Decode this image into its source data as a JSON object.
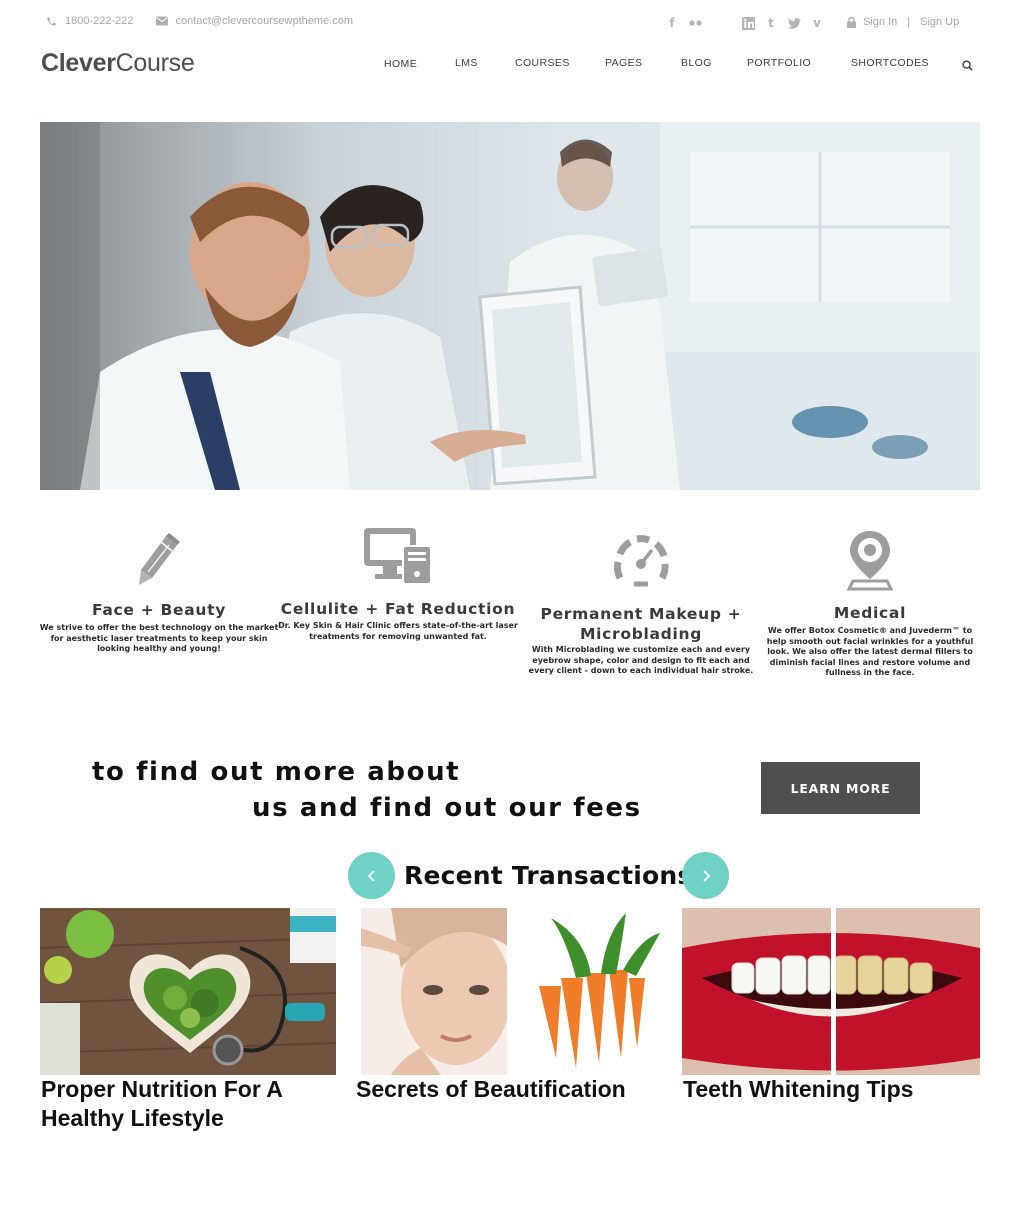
{
  "topbar": {
    "phone": "1800-222-222",
    "email": "contact@clevercoursewptheme.com",
    "sign_in": "Sign In",
    "separator": "|",
    "sign_up": "Sign Up",
    "social_icons": [
      "facebook-icon",
      "flickr-icon",
      "linkedin-icon",
      "tumblr-icon",
      "twitter-icon",
      "vimeo-icon"
    ]
  },
  "logo": {
    "bold": "Clever",
    "light": "Course"
  },
  "nav": {
    "items": [
      "HOME",
      "LMS",
      "COURSES",
      "PAGES",
      "BLOG",
      "PORTFOLIO",
      "SHORTCODES"
    ],
    "search_icon": "search-icon"
  },
  "features": [
    {
      "icon": "pencil-icon",
      "title": "Face + Beauty",
      "text": "We strive to offer the best technology on the market for aesthetic laser treatments to keep your skin looking healthy and young!"
    },
    {
      "icon": "computer-icon",
      "title": "Cellulite + Fat Reduction",
      "text": "Dr. Key Skin & Hair Clinic offers state-of-the-art laser treatments for removing unwanted fat."
    },
    {
      "icon": "speedometer-icon",
      "title_line1": "Permanent Makeup +",
      "title_line2": "Microblading",
      "text": "With Microblading we customize each and every eyebrow shape, color and design to fit each and every client - down to each individual hair stroke."
    },
    {
      "icon": "map-pin-icon",
      "title": "Medical",
      "text": "We offer Botox Cosmetic® and Juvederm™ to help smooth out facial wrinkles for a youthful look. We also offer the latest dermal fillers to diminish facial lines and restore volume and fullness in the face."
    }
  ],
  "cta": {
    "line1": "to find out more about",
    "line2": "us and find out our fees",
    "button": "LEARN MORE"
  },
  "recent": {
    "title": "Recent Transactions",
    "prev_icon": "chevron-left-icon",
    "next_icon": "chevron-right-icon",
    "cards": [
      {
        "title_line1": "Proper Nutrition For A",
        "title_line2": "Healthy Lifestyle"
      },
      {
        "title": "Secrets of Beautification"
      },
      {
        "title": "Teeth Whitening Tips"
      }
    ]
  },
  "colors": {
    "accent_teal": "#6fd1c6",
    "button_dark": "#4f4f4f",
    "muted_text": "#a7a7a7",
    "icon_gray": "#9a9a9a"
  }
}
